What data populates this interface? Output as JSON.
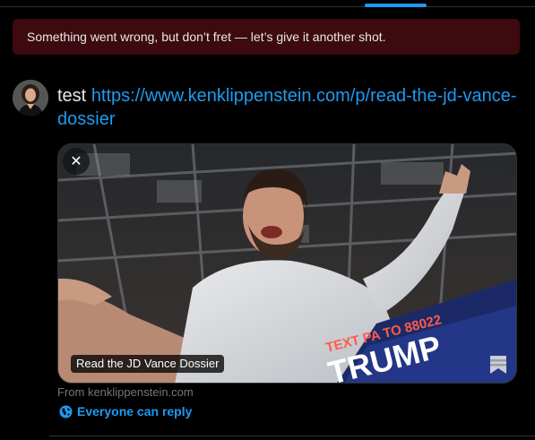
{
  "error_banner": {
    "message": "Something went wrong, but don’t fret — let’s give it another shot."
  },
  "tweet": {
    "text": "test",
    "link": "https://www.kenklippenstein.com/p/read-the-jd-vance-dossier"
  },
  "card": {
    "remove_label": "✕",
    "title": "Read the JD Vance Dossier",
    "source": "From kenklippenstein.com",
    "photo_sign_line1": "TEXT PA TO 88022",
    "photo_sign_line2": "TRUMP"
  },
  "reply_setting": {
    "label": "Everyone can reply"
  },
  "colors": {
    "accent": "#1d9bf0",
    "error_bg": "#3d0a10",
    "muted": "#71767b"
  }
}
